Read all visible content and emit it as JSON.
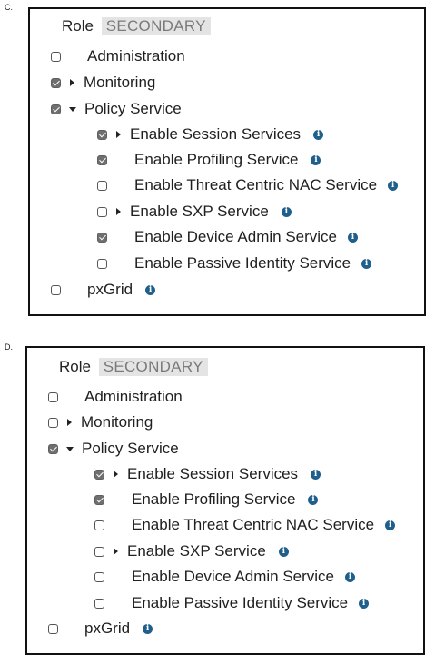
{
  "panels": [
    {
      "letter": "C.",
      "role_label": "Role",
      "role_value": "SECONDARY",
      "items": {
        "administration": {
          "label": "Administration",
          "checked": false
        },
        "monitoring": {
          "label": "Monitoring",
          "checked": true,
          "expanded": false
        },
        "policy_service": {
          "label": "Policy Service",
          "checked": true,
          "expanded": true
        },
        "session_services": {
          "label": "Enable Session Services",
          "checked": true,
          "expanded": false
        },
        "profiling_service": {
          "label": "Enable Profiling Service",
          "checked": true
        },
        "threat_centric_nac": {
          "label": "Enable Threat Centric NAC Service",
          "checked": false
        },
        "sxp_service": {
          "label": "Enable SXP Service",
          "checked": false,
          "expanded": false
        },
        "device_admin": {
          "label": "Enable Device Admin Service",
          "checked": true
        },
        "passive_identity": {
          "label": "Enable Passive Identity Service",
          "checked": false
        },
        "pxgrid": {
          "label": "pxGrid",
          "checked": false
        }
      }
    },
    {
      "letter": "D.",
      "role_label": "Role",
      "role_value": "SECONDARY",
      "items": {
        "administration": {
          "label": "Administration",
          "checked": false
        },
        "monitoring": {
          "label": "Monitoring",
          "checked": false,
          "expanded": false
        },
        "policy_service": {
          "label": "Policy Service",
          "checked": true,
          "expanded": true
        },
        "session_services": {
          "label": "Enable Session Services",
          "checked": true,
          "expanded": false
        },
        "profiling_service": {
          "label": "Enable Profiling Service",
          "checked": true
        },
        "threat_centric_nac": {
          "label": "Enable Threat Centric NAC Service",
          "checked": false
        },
        "sxp_service": {
          "label": "Enable SXP Service",
          "checked": false,
          "expanded": false
        },
        "device_admin": {
          "label": "Enable Device Admin Service",
          "checked": false
        },
        "passive_identity": {
          "label": "Enable Passive Identity Service",
          "checked": false
        },
        "pxgrid": {
          "label": "pxGrid",
          "checked": false
        }
      }
    }
  ],
  "icons": {
    "info": "info-icon",
    "checkbox": "checkbox",
    "caret": "caret-icon"
  },
  "colors": {
    "info_icon": "#1f5f8b",
    "checkbox_checked": "#6f6f6f",
    "badge_bg": "#e4e4e4",
    "badge_text": "#7a7a7a"
  }
}
